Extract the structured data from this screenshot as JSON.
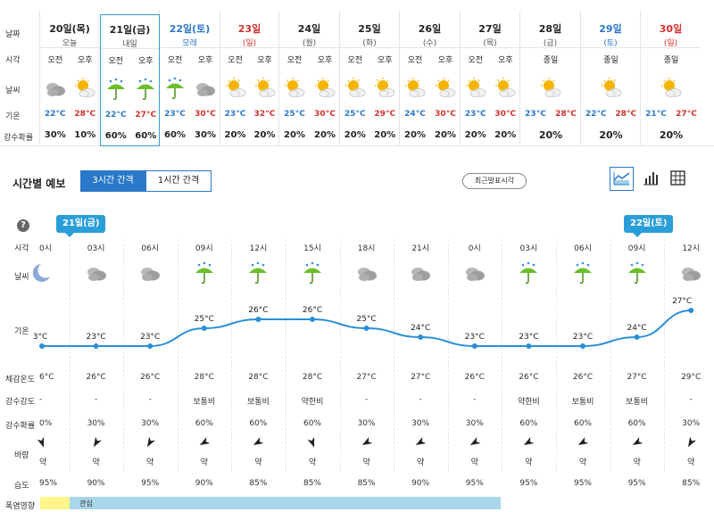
{
  "weekly": {
    "row_labels": {
      "date": "날짜",
      "time": "시각",
      "weather": "날씨",
      "temp": "기온",
      "pop": "강수확률"
    },
    "days": [
      {
        "date": "20일(목)",
        "sub": "오늘",
        "kind": "",
        "split": true,
        "am": {
          "label": "오전",
          "icon": "cloudy-icon",
          "pop": "30%"
        },
        "pm": {
          "label": "오후",
          "icon": "partly-cloudy-icon",
          "pop": "10%"
        },
        "lo": "22°C",
        "hi": "28°C"
      },
      {
        "date": "21일(금)",
        "sub": "내일",
        "kind": "",
        "split": true,
        "selected": true,
        "am": {
          "label": "오전",
          "icon": "rain-umbrella-icon",
          "pop": "60%"
        },
        "pm": {
          "label": "오후",
          "icon": "rain-umbrella-icon",
          "pop": "60%"
        },
        "lo": "22°C",
        "hi": "27°C"
      },
      {
        "date": "22일(토)",
        "sub": "모레",
        "kind": "sat",
        "split": true,
        "am": {
          "label": "오전",
          "icon": "rain-umbrella-icon",
          "pop": "60%"
        },
        "pm": {
          "label": "오후",
          "icon": "cloudy-icon",
          "pop": "30%"
        },
        "lo": "23°C",
        "hi": "30°C"
      },
      {
        "date": "23일",
        "sub": "(일)",
        "kind": "sun",
        "split": true,
        "am": {
          "label": "오전",
          "icon": "partly-cloudy-icon",
          "pop": "20%"
        },
        "pm": {
          "label": "오후",
          "icon": "partly-cloudy-icon",
          "pop": "20%"
        },
        "lo": "23°C",
        "hi": "32°C"
      },
      {
        "date": "24일",
        "sub": "(월)",
        "kind": "",
        "split": true,
        "am": {
          "label": "오전",
          "icon": "partly-cloudy-icon",
          "pop": "20%"
        },
        "pm": {
          "label": "오후",
          "icon": "partly-cloudy-icon",
          "pop": "20%"
        },
        "lo": "25°C",
        "hi": "30°C"
      },
      {
        "date": "25일",
        "sub": "(화)",
        "kind": "",
        "split": true,
        "am": {
          "label": "오전",
          "icon": "partly-cloudy-icon",
          "pop": "20%"
        },
        "pm": {
          "label": "오후",
          "icon": "partly-cloudy-icon",
          "pop": "20%"
        },
        "lo": "25°C",
        "hi": "29°C"
      },
      {
        "date": "26일",
        "sub": "(수)",
        "kind": "",
        "split": true,
        "am": {
          "label": "오전",
          "icon": "partly-cloudy-icon",
          "pop": "20%"
        },
        "pm": {
          "label": "오후",
          "icon": "partly-cloudy-icon",
          "pop": "20%"
        },
        "lo": "24°C",
        "hi": "30°C"
      },
      {
        "date": "27일",
        "sub": "(목)",
        "kind": "",
        "split": true,
        "am": {
          "label": "오전",
          "icon": "partly-cloudy-icon",
          "pop": "20%"
        },
        "pm": {
          "label": "오후",
          "icon": "partly-cloudy-icon",
          "pop": "20%"
        },
        "lo": "23°C",
        "hi": "30°C"
      },
      {
        "date": "28일",
        "sub": "(금)",
        "kind": "",
        "split": false,
        "full": {
          "label": "종일",
          "icon": "partly-cloudy-icon",
          "pop": "20%"
        },
        "lo": "23°C",
        "hi": "28°C"
      },
      {
        "date": "29일",
        "sub": "(토)",
        "kind": "sat",
        "split": false,
        "full": {
          "label": "종일",
          "icon": "partly-cloudy-icon",
          "pop": "20%"
        },
        "lo": "22°C",
        "hi": "28°C"
      },
      {
        "date": "30일",
        "sub": "(일)",
        "kind": "sun",
        "split": false,
        "full": {
          "label": "종일",
          "icon": "partly-cloudy-icon",
          "pop": "20%"
        },
        "lo": "21°C",
        "hi": "27°C"
      }
    ]
  },
  "hourly": {
    "title": "시간별 예보",
    "tab_3h": "3시간 간격",
    "tab_1h": "1시간 간격",
    "recent_button": "최근발표시각",
    "view_icons": [
      "graph-view-icon",
      "bar-chart-icon",
      "table-view-icon"
    ],
    "help": "?",
    "date_flags": [
      "21일(금)",
      "22일(토)"
    ],
    "row_labels": {
      "time": "시각",
      "weather": "날씨",
      "temp": "기온",
      "feels": "체감온도",
      "intensity": "강수강도",
      "pop": "강수확률",
      "wind": "바람",
      "humidity": "습도",
      "heat": "폭염영향"
    },
    "slots": [
      {
        "time": "0시",
        "icon": "crescent-moon-icon",
        "temp": 23,
        "temp_label": "3°C",
        "feels": "6°C",
        "intensity": "-",
        "pop": "0%",
        "wind_dir": 160,
        "wind": "약",
        "humidity": "95%"
      },
      {
        "time": "03시",
        "icon": "cloudy-icon",
        "temp": 23,
        "temp_label": "23°C",
        "feels": "26°C",
        "intensity": "-",
        "pop": "30%",
        "wind_dir": 210,
        "wind": "약",
        "humidity": "90%"
      },
      {
        "time": "06시",
        "icon": "cloudy-icon",
        "temp": 23,
        "temp_label": "23°C",
        "feels": "26°C",
        "intensity": "-",
        "pop": "30%",
        "wind_dir": 210,
        "wind": "약",
        "humidity": "95%"
      },
      {
        "time": "09시",
        "icon": "rain-umbrella-icon",
        "temp": 25,
        "temp_label": "25°C",
        "feels": "28°C",
        "intensity": "보통비",
        "pop": "60%",
        "wind_dir": 240,
        "wind": "약",
        "humidity": "90%"
      },
      {
        "time": "12시",
        "icon": "rain-umbrella-icon",
        "temp": 26,
        "temp_label": "26°C",
        "feels": "28°C",
        "intensity": "보통비",
        "pop": "60%",
        "wind_dir": 240,
        "wind": "약",
        "humidity": "85%"
      },
      {
        "time": "15시",
        "icon": "rain-umbrella-icon",
        "temp": 26,
        "temp_label": "26°C",
        "feels": "28°C",
        "intensity": "약한비",
        "pop": "60%",
        "wind_dir": 160,
        "wind": "약",
        "humidity": "85%"
      },
      {
        "time": "18시",
        "icon": "cloudy-icon",
        "temp": 25,
        "temp_label": "25°C",
        "feels": "27°C",
        "intensity": "-",
        "pop": "30%",
        "wind_dir": 240,
        "wind": "약",
        "humidity": "85%"
      },
      {
        "time": "21시",
        "icon": "cloudy-icon",
        "temp": 24,
        "temp_label": "24°C",
        "feels": "27°C",
        "intensity": "-",
        "pop": "30%",
        "wind_dir": 240,
        "wind": "약",
        "humidity": "90%"
      },
      {
        "time": "0시",
        "icon": "cloudy-icon",
        "temp": 23,
        "temp_label": "23°C",
        "feels": "26°C",
        "intensity": "-",
        "pop": "30%",
        "wind_dir": 240,
        "wind": "약",
        "humidity": "95%"
      },
      {
        "time": "03시",
        "icon": "rain-umbrella-icon",
        "temp": 23,
        "temp_label": "23°C",
        "feels": "26°C",
        "intensity": "약한비",
        "pop": "60%",
        "wind_dir": 240,
        "wind": "약",
        "humidity": "95%"
      },
      {
        "time": "06시",
        "icon": "rain-umbrella-icon",
        "temp": 23,
        "temp_label": "23°C",
        "feels": "26°C",
        "intensity": "보통비",
        "pop": "60%",
        "wind_dir": 240,
        "wind": "약",
        "humidity": "95%"
      },
      {
        "time": "09시",
        "icon": "rain-umbrella-icon",
        "temp": 24,
        "temp_label": "24°C",
        "feels": "27°C",
        "intensity": "보통비",
        "pop": "60%",
        "wind_dir": 240,
        "wind": "약",
        "humidity": "95%"
      },
      {
        "time": "12시",
        "icon": "cloudy-icon",
        "temp": 27,
        "temp_label": "27°C",
        "feels": "29°C",
        "intensity": "-",
        "pop": "30%",
        "wind_dir": 210,
        "wind": "약",
        "humidity": "85%"
      }
    ],
    "heat": {
      "label": "관심",
      "yellow": "#fff68a",
      "blue": "#a9d6e8"
    }
  },
  "colors": {
    "accent": "#2a78c8",
    "flag": "#2a9ed9",
    "line": "#2a8fd6",
    "lo": "#2a78c8",
    "hi": "#d0312d"
  }
}
